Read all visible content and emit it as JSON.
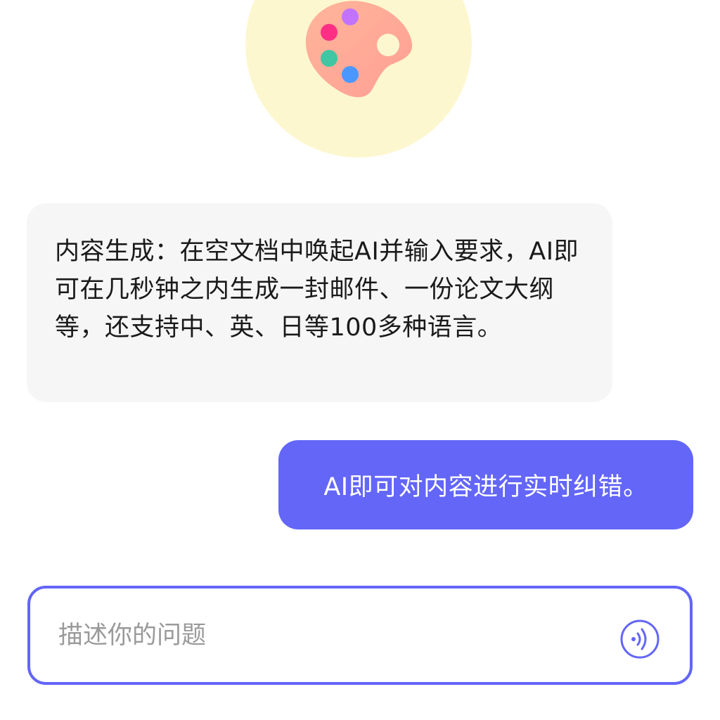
{
  "header": {
    "avatar_icon": "palette-icon",
    "avatar_bg": "#fdf7cf"
  },
  "messages": [
    {
      "role": "assistant",
      "text": "内容生成：在空文档中唤起AI并输入要求，AI即可在几秒钟之内生成一封邮件、一份论文大纲等，还支持中、英、日等100多种语言。"
    },
    {
      "role": "user",
      "text": "AI即可对内容进行实时纠错。"
    }
  ],
  "composer": {
    "placeholder": "描述你的问题",
    "value": "",
    "voice_icon": "voice-input-icon"
  },
  "colors": {
    "accent": "#6366f7",
    "assistant_bubble": "#f6f6f6",
    "text": "#1a1a1a",
    "placeholder": "#9a9a9a"
  }
}
